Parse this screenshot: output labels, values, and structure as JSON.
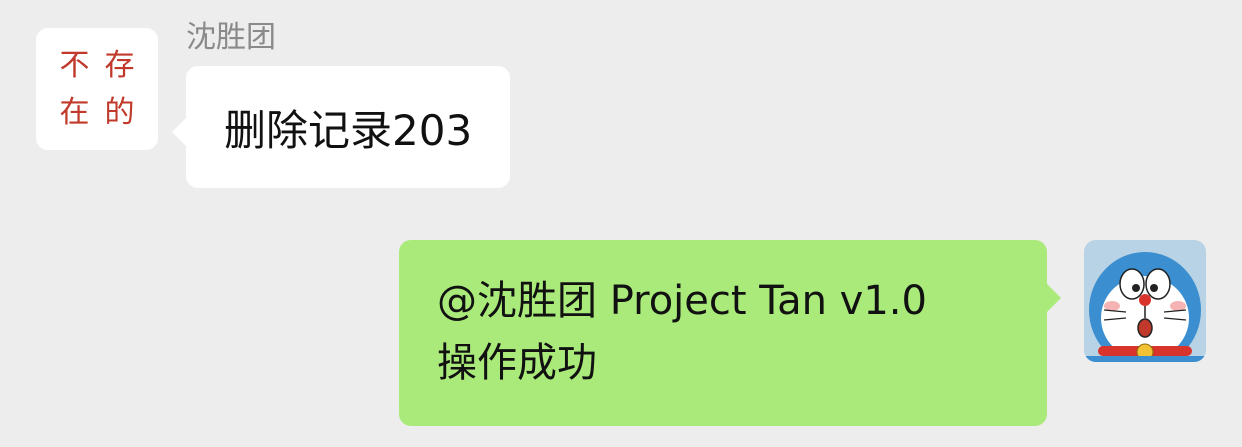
{
  "incoming": {
    "sender_name": "沈胜团",
    "avatar_text": [
      "不",
      "存",
      "在",
      "的"
    ],
    "message": "删除记录203"
  },
  "outgoing": {
    "message_line1": "@沈胜团 Project Tan v1.0",
    "message_line2": "操作成功"
  },
  "colors": {
    "background": "#ededed",
    "incoming_bubble": "#ffffff",
    "outgoing_bubble": "#a9ea7a",
    "avatar_text": "#c0392b",
    "sender_name": "#8a8a8a"
  },
  "icons": {
    "sender_avatar": "text-avatar",
    "self_avatar": "doraemon-avatar"
  }
}
